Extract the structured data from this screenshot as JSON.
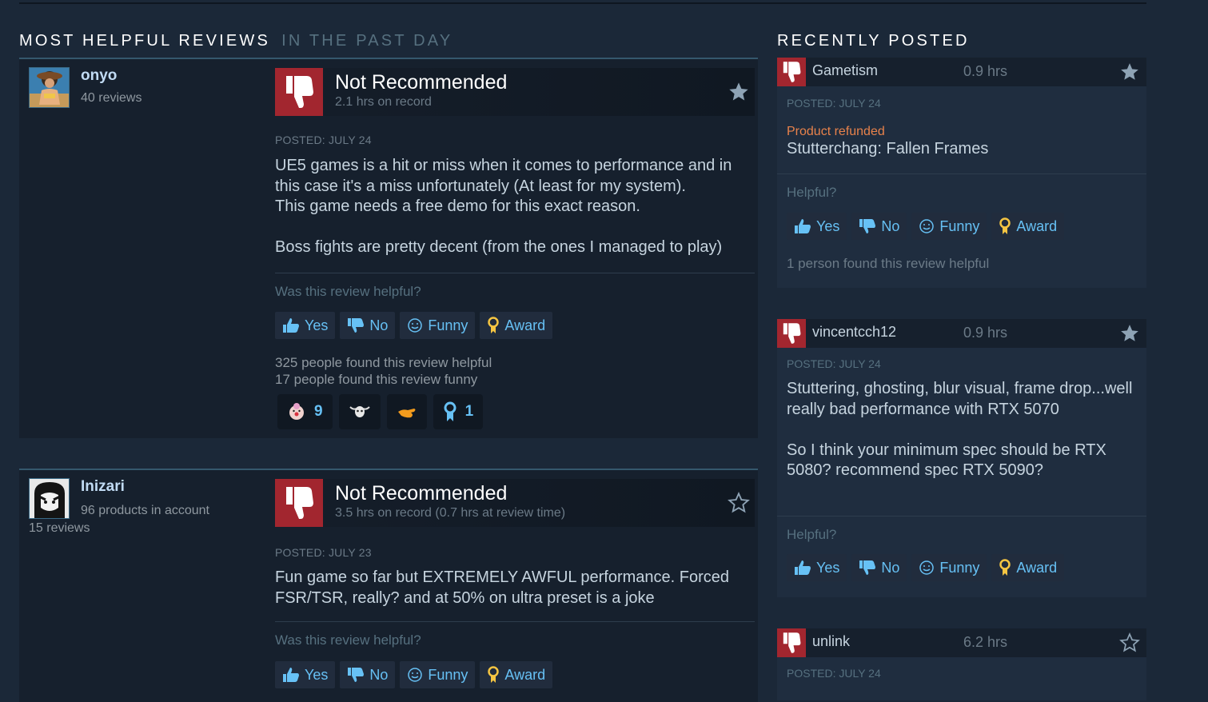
{
  "colors": {
    "background": "#1b2838",
    "negative": "#a2262f",
    "link": "#66c0f4",
    "refunded": "#e8824b",
    "award_gold": "#f5c542"
  },
  "left_section": {
    "title": "MOST HELPFUL REVIEWS",
    "subtitle": "IN THE PAST DAY"
  },
  "right_section": {
    "title": "RECENTLY POSTED"
  },
  "reviews": [
    {
      "author": "onyo",
      "author_meta1": "40 reviews",
      "author_meta2": "",
      "verdict": "Not Recommended",
      "hours": "2.1 hrs on record",
      "posted": "POSTED: JULY 24",
      "content": [
        "UE5 games is a hit or miss when it comes to performance and in this case it's a miss unfortunately (At least for my system).\nThis game needs a free demo for this exact reason.",
        "Boss fights are pretty decent (from the ones I managed to play)"
      ],
      "helpful_question": "Was this review helpful?",
      "buttons": {
        "yes": "Yes",
        "no": "No",
        "funny": "Funny",
        "award": "Award"
      },
      "stat_helpful": "325 people found this review helpful",
      "stat_funny": "17 people found this review funny",
      "awards": [
        {
          "icon": "clown-face-award-icon",
          "count": "9"
        },
        {
          "icon": "cow-skull-award-icon",
          "count": ""
        },
        {
          "icon": "golden-hand-award-icon",
          "count": ""
        },
        {
          "icon": "ribbon-award-icon",
          "count": "1"
        }
      ]
    },
    {
      "author": "Inizari",
      "author_meta1": "96 products in account",
      "author_meta2": "15 reviews",
      "verdict": "Not Recommended",
      "hours": "3.5 hrs on record (0.7 hrs at review time)",
      "posted": "POSTED: JULY 23",
      "content": [
        "Fun game so far but EXTREMELY AWFUL performance. Forced FSR/TSR, really? and at 50% on ultra preset is a joke"
      ],
      "helpful_question": "Was this review helpful?",
      "buttons": {
        "yes": "Yes",
        "no": "No",
        "funny": "Funny",
        "award": "Award"
      }
    }
  ],
  "recent": [
    {
      "author": "Gametism",
      "hours": "0.9 hrs",
      "posted": "POSTED: JULY 24",
      "refunded": "Product refunded",
      "content": [
        "Stutterchang: Fallen Frames"
      ],
      "helpful_question": "Helpful?",
      "buttons": {
        "yes": "Yes",
        "no": "No",
        "funny": "Funny",
        "award": "Award"
      },
      "stat": "1 person found this review helpful"
    },
    {
      "author": "vincentcch12",
      "hours": "0.9 hrs",
      "posted": "POSTED: JULY 24",
      "content": [
        "Stuttering, ghosting, blur visual, frame drop...well really bad performance with RTX 5070",
        "So I think your minimum spec should be RTX 5080? recommend spec RTX 5090?"
      ],
      "helpful_question": "Helpful?",
      "buttons": {
        "yes": "Yes",
        "no": "No",
        "funny": "Funny",
        "award": "Award"
      }
    },
    {
      "author": "unlink",
      "hours": "6.2 hrs",
      "posted": "POSTED: JULY 24"
    }
  ]
}
